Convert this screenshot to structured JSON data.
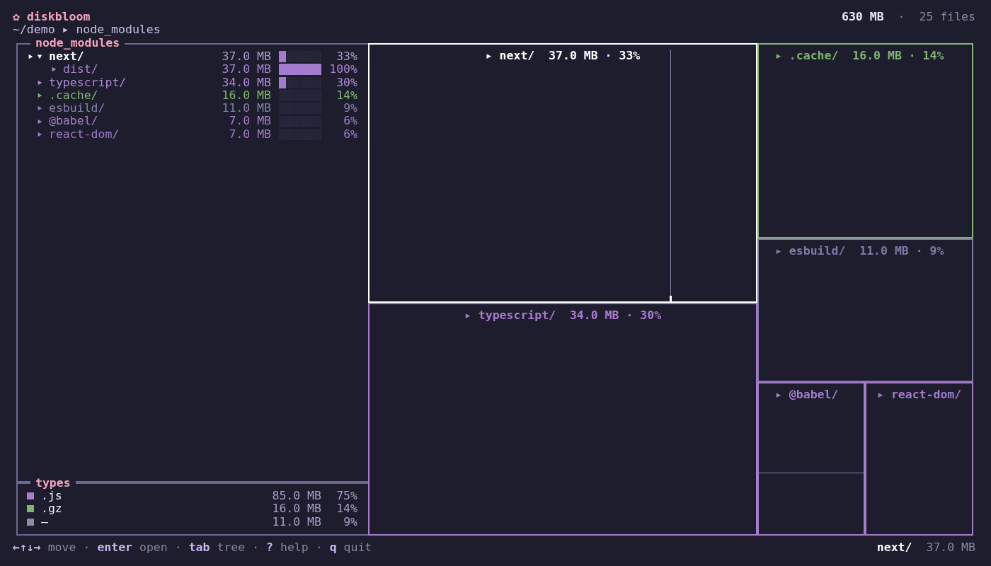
{
  "header": {
    "logo": "✿",
    "app_name": "diskbloom",
    "path": "~/demo ▸ node_modules",
    "total": "630 MB",
    "separator": "·",
    "file_count": "25 files"
  },
  "tree": {
    "title": "node_modules",
    "items": [
      {
        "name": "next/",
        "size": "37.0 MB",
        "percent": "33%",
        "level": 0.17,
        "selected": true,
        "expanded": true,
        "children": [
          {
            "name": "dist/",
            "size": "37.0 MB",
            "percent": "100%",
            "level": 1,
            "color": "#a884cf",
            "selected": false,
            "expanded": false
          }
        ]
      },
      {
        "name": "typescript/",
        "size": "34.0 MB",
        "percent": "30%",
        "level": 0.17,
        "color": "#b08ad8",
        "selected": false,
        "expanded": false
      },
      {
        "name": ".cache/",
        "size": "16.0 MB",
        "percent": "14%",
        "level": 0,
        "color": "#7fb56f",
        "selected": false,
        "expanded": false
      },
      {
        "name": "esbuild/",
        "size": "11.0 MB",
        "percent": "9%",
        "level": 0,
        "color": "#8580a8",
        "selected": false,
        "expanded": false
      },
      {
        "name": "@babel/",
        "size": "7.0 MB",
        "percent": "6%",
        "level": 0,
        "color": "#a47dc8",
        "selected": false,
        "expanded": false
      },
      {
        "name": "react-dom/",
        "size": "7.0 MB",
        "percent": "6%",
        "level": 0,
        "color": "#9f7ac6",
        "selected": false,
        "expanded": false
      }
    ]
  },
  "types": {
    "title": "types",
    "items": [
      {
        "name": ".js",
        "size": "85.0 MB",
        "percent": "75%",
        "color": "#a87ccf"
      },
      {
        "name": ".gz",
        "size": "16.0 MB",
        "percent": "14%",
        "color": "#7fb56f"
      },
      {
        "name": "—",
        "size": "11.0 MB",
        "percent": "9%",
        "color": "#8f8aaa"
      }
    ]
  },
  "treemap": {
    "tiles": [
      {
        "label": "▸ next/  37.0 MB · 33%",
        "selected": true
      },
      {
        "label": "▸ typescript/  34.0 MB · 30%",
        "color": "#a87ccf",
        "selected": false
      },
      {
        "label": "▸ .cache/  16.0 MB · 14%",
        "color": "#7fb56f",
        "selected": false
      },
      {
        "label": "▸ esbuild/  11.0 MB · 9%",
        "color": "#7f7aa6",
        "selected": false
      },
      {
        "label": "▸ @babel/",
        "color": "#a47dc8",
        "selected": false
      },
      {
        "label": "▸ react-dom/",
        "color": "#a37bc9",
        "selected": false
      }
    ]
  },
  "footer": {
    "separator": "·",
    "hints": [
      {
        "key": "←↑↓→",
        "action": "move"
      },
      {
        "key": "enter",
        "action": "open"
      },
      {
        "key": "tab",
        "action": "tree"
      },
      {
        "key": "?",
        "action": "help"
      },
      {
        "key": "q",
        "action": "quit"
      }
    ],
    "status": {
      "name": "next/",
      "size": "37.0 MB"
    }
  }
}
